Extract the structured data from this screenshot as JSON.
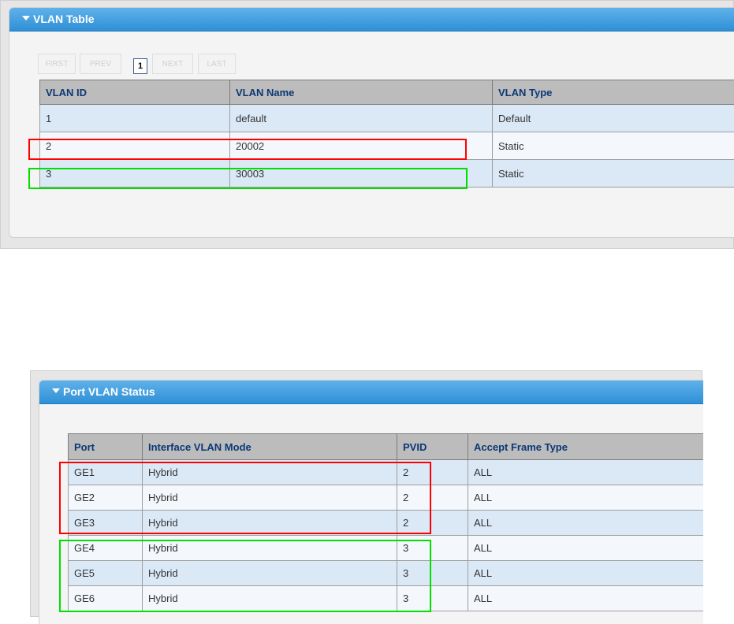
{
  "vlan_table": {
    "title": "VLAN Table",
    "pager": {
      "first": "FIRST",
      "prev": "PREV",
      "page": "1",
      "next": "NEXT",
      "last": "LAST"
    },
    "columns": [
      "VLAN ID",
      "VLAN Name",
      "VLAN Type"
    ],
    "rows": [
      [
        "1",
        "default",
        "Default"
      ],
      [
        "2",
        "20002",
        "Static"
      ],
      [
        "3",
        "30003",
        "Static"
      ]
    ]
  },
  "port_vlan_status": {
    "title": "Port VLAN Status",
    "columns": [
      "Port",
      "Interface VLAN Mode",
      "PVID",
      "Accept Frame Type"
    ],
    "rows": [
      [
        "GE1",
        "Hybrid",
        "2",
        "ALL"
      ],
      [
        "GE2",
        "Hybrid",
        "2",
        "ALL"
      ],
      [
        "GE3",
        "Hybrid",
        "2",
        "ALL"
      ],
      [
        "GE4",
        "Hybrid",
        "3",
        "ALL"
      ],
      [
        "GE5",
        "Hybrid",
        "3",
        "ALL"
      ],
      [
        "GE6",
        "Hybrid",
        "3",
        "ALL"
      ]
    ]
  },
  "colors": {
    "title_bar": "#3a98dc",
    "header_bg": "#bcbcbc",
    "header_text": "#0c3876",
    "row_odd": "#dbe9f7",
    "row_even": "#f4f8fc",
    "highlight_red": "#ff0000",
    "highlight_green": "#00e000"
  }
}
